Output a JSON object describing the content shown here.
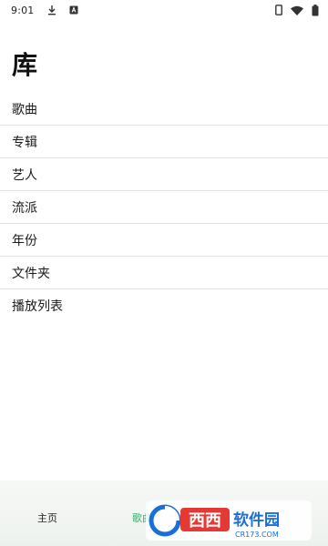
{
  "status_bar": {
    "time": "9:01",
    "left_icons": [
      "download-icon",
      "accessibility-icon"
    ],
    "right_icons": [
      "phone-icon",
      "wifi-icon",
      "battery-icon"
    ]
  },
  "page": {
    "title": "库"
  },
  "library": {
    "items": [
      {
        "label": "歌曲"
      },
      {
        "label": "专辑"
      },
      {
        "label": "艺人"
      },
      {
        "label": "流派"
      },
      {
        "label": "年份"
      },
      {
        "label": "文件夹"
      },
      {
        "label": "播放列表"
      }
    ]
  },
  "bottom_nav": {
    "items": [
      {
        "label": "主页",
        "active": false
      },
      {
        "label": "歌曲",
        "active": true
      }
    ],
    "active_color": "#2bb36a"
  },
  "watermark": {
    "text": "西西软件园",
    "subtext": "CR173.COM",
    "color": "#1a6fd6"
  }
}
